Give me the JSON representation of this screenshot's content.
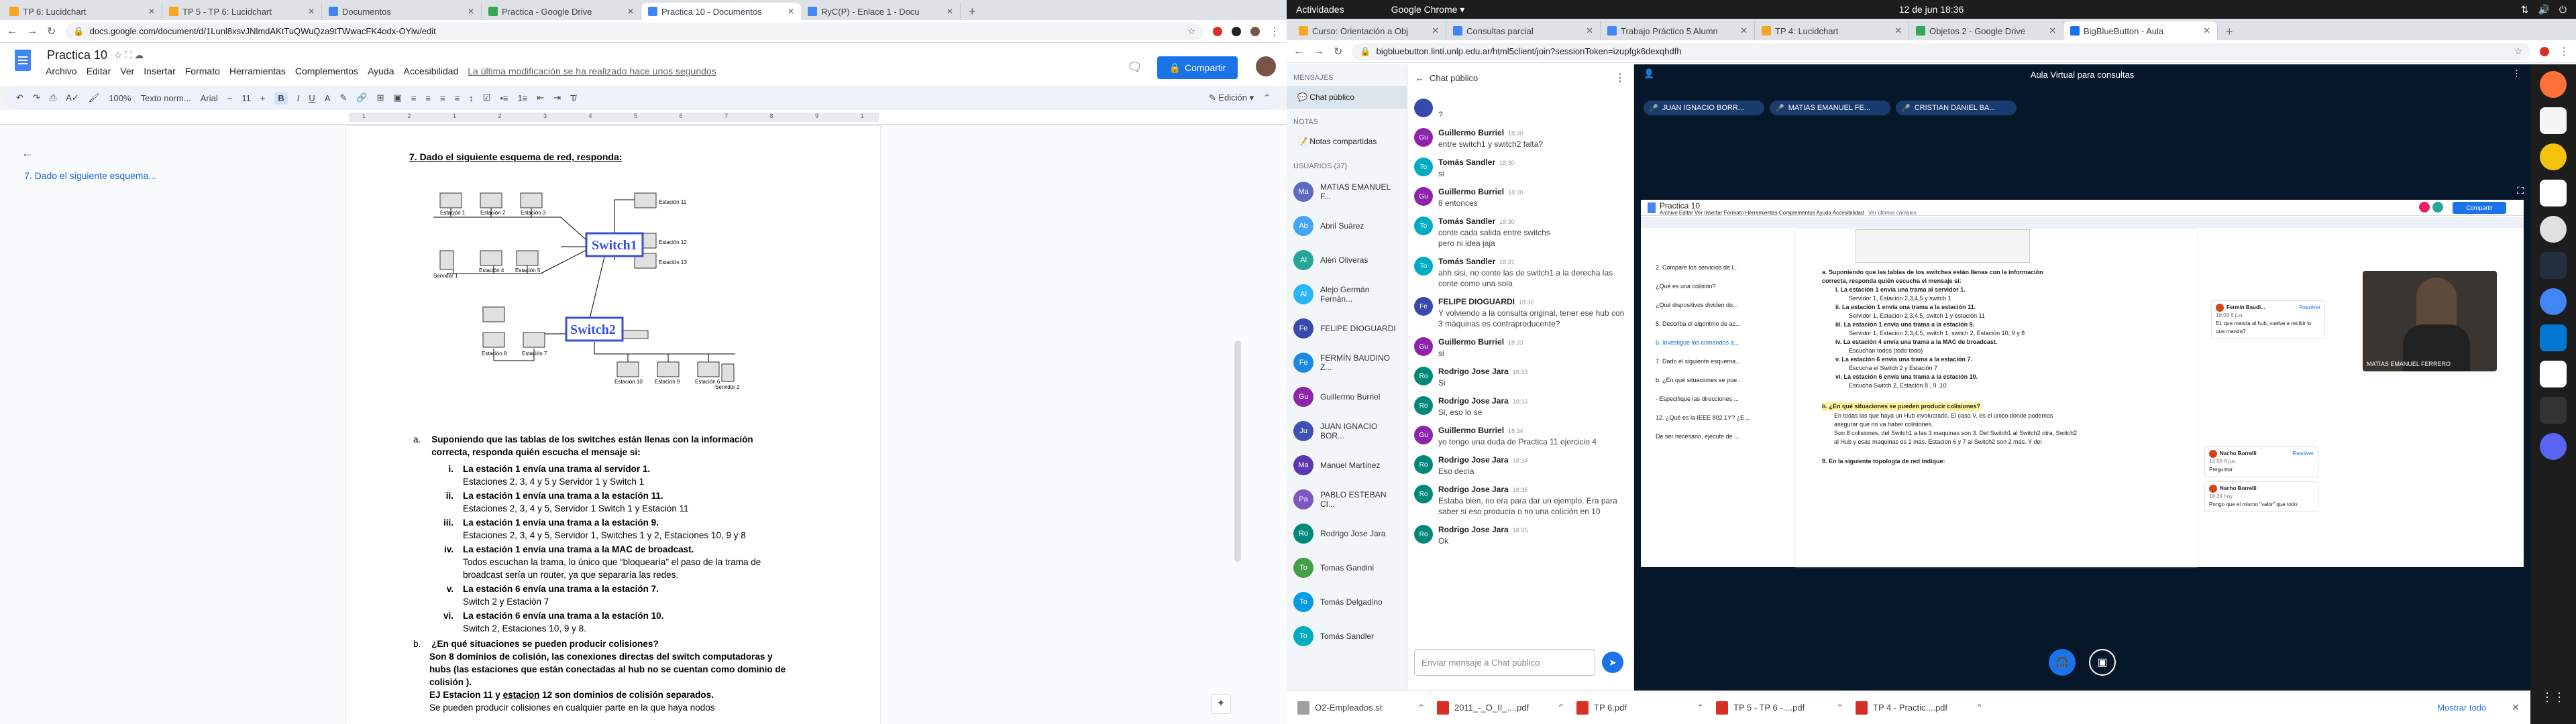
{
  "left_browser": {
    "tabs": [
      {
        "label": "TP 6: Lucidchart",
        "color": "#f5a623"
      },
      {
        "label": "TP 5 - TP 6: Lucidchart",
        "color": "#f5a623"
      },
      {
        "label": "Documentos",
        "color": "#4285f4"
      },
      {
        "label": "Practica - Google Drive",
        "color": "#34a853"
      },
      {
        "label": "Practica 10 - Documentos",
        "color": "#4285f4"
      },
      {
        "label": "RyC(P) - Enlace 1 - Docu",
        "color": "#4285f4"
      }
    ],
    "active_tab_index": 4,
    "url": "docs.google.com/document/d/1Lunl8xsvJNlmdAKtTuQWuQza9tTWwacFK4odx-OYiw/edit"
  },
  "docs": {
    "title": "Practica 10",
    "menus": [
      "Archivo",
      "Editar",
      "Ver",
      "Insertar",
      "Formato",
      "Herramientas",
      "Complementos",
      "Ayuda",
      "Accesibilidad"
    ],
    "last_edit": "La última modificación se ha realizado hace unos segundos",
    "share_label": "Compartir",
    "toolbar": {
      "zoom": "100%",
      "style": "Texto norm...",
      "font": "Arial",
      "size": "11",
      "mode": "Edición"
    },
    "ruler_numbers": "1 2 1 2 3 4 5 6 7 8 9 10 11 12 13 14 15 16 17 18",
    "outline_item": "7. Dado el siguiente esquema...",
    "question_title": "7. Dado el siguiente esquema de red, responda:",
    "diagram": {
      "switch1": "Switch1",
      "switch2": "Switch2",
      "labels": [
        "Estación 1",
        "Estación 2",
        "Estación 3",
        "Estación 11",
        "Estación 12",
        "Servidor 1",
        "Estación 4",
        "Estación 5",
        "Estación 13",
        "Estación 8",
        "Estación 7",
        "Estación 9",
        "Estación 10",
        "Servidor 2",
        "Estación 6"
      ]
    },
    "a_label": "a.",
    "a_text": "Suponiendo que las tablas de los switches están llenas con la información correcta, responda quién escucha el mensaje si:",
    "items": [
      {
        "num": "i.",
        "q": "La estación 1 envía una trama al servidor 1.",
        "a": "Estaciones 2, 3, 4 y 5 y Servidor 1 y Switch 1"
      },
      {
        "num": "ii.",
        "q": "La estación 1 envía una trama a la estación 11.",
        "a": "Estaciones 2, 3, 4 y 5, Servidor 1 Switch 1 y Estación 11"
      },
      {
        "num": "iii.",
        "q": "La estación 1 envía una trama a la estación 9.",
        "a": "Estaciones 2, 3, 4 y 5, Servidor 1, Switches 1 y 2, Estaciones 10, 9 y 8"
      },
      {
        "num": "iv.",
        "q": "La estación 1 envía una trama a la MAC de broadcast.",
        "a": "Todos escuchan la trama, lo único que “bloquearía” el paso de la trama de broadcast sería un router, ya que separaría las redes."
      },
      {
        "num": "v.",
        "q": "La estación 6 envía una trama a la estación 7.",
        "a": "Switch 2 y Estación 7"
      },
      {
        "num": "vi.",
        "q": "La estación 6 envía una trama a la estación 10.",
        "a": "Switch 2, Estaciones 10, 9 y 8."
      }
    ],
    "b_label": "b.",
    "b_q": "¿En qué situaciones se pueden producir colisiones?",
    "b_a1": "Son 8 dominios de colisión, las conexiones directas del switch computadoras y hubs (las estaciones que están conectadas al hub no se cuentan como dominio de colisión ).",
    "b_a2_pre": "EJ Estacion 11 y ",
    "b_a2_u": "estacion",
    "b_a2_post": " 12 son dominios de colisión separados.",
    "b_a3": "Se pueden producir colisiones en cualquier parte en la que haya nodos"
  },
  "gnome": {
    "activities": "Actividades",
    "app": "Google Chrome ▾",
    "clock": "12 de jun  18:36"
  },
  "right_browser": {
    "tabs": [
      {
        "label": "Curso: Orientación a Obj",
        "color": "#f9a825"
      },
      {
        "label": "Consultas parcial",
        "color": "#4285f4"
      },
      {
        "label": "Trabajo Práctico 5 Alumn",
        "color": "#4285f4"
      },
      {
        "label": "TP 4: Lucidchart",
        "color": "#f5a623"
      },
      {
        "label": "Objetos 2 - Google Drive",
        "color": "#34a853"
      },
      {
        "label": "BigBlueButton - Aula",
        "color": "#1a73e8"
      }
    ],
    "url": "bigbluebutton.linti.unlp.edu.ar/html5client/join?sessionToken=izupfgk6dexqhdfh"
  },
  "bbb": {
    "messages_header": "MENSAJES",
    "public_chat": "Chat público",
    "notes_header": "NOTAS",
    "shared_notes": "Notas compartidas",
    "users_header": "USUARIOS (37)",
    "users": [
      {
        "initials": "Ma",
        "name": "MATIAS EMANUEL F...",
        "color": "#5c6bc0"
      },
      {
        "initials": "Ab",
        "name": "Abril Suárez",
        "color": "#42a5f5"
      },
      {
        "initials": "Al",
        "name": "Alén Oliveras",
        "color": "#26a69a"
      },
      {
        "initials": "Al",
        "name": "Alejo Germán Fernán...",
        "color": "#29b6f6"
      },
      {
        "initials": "Fe",
        "name": "FELIPE DIOGUARDI",
        "color": "#3949ab"
      },
      {
        "initials": "Fe",
        "name": "FERMÍN BAUDINO Z...",
        "color": "#1e88e5"
      },
      {
        "initials": "Gu",
        "name": "Guillermo Burriel",
        "color": "#8e24aa"
      },
      {
        "initials": "Ju",
        "name": "JUAN IGNACIO BOR...",
        "color": "#3f51b5"
      },
      {
        "initials": "Ma",
        "name": "Manuel Martínez",
        "color": "#5e35b1"
      },
      {
        "initials": "Pa",
        "name": "PABLO ESTEBAN CI...",
        "color": "#7e57c2"
      },
      {
        "initials": "Ro",
        "name": "Rodrigo Jose Jara",
        "color": "#00897b"
      },
      {
        "initials": "To",
        "name": "Tomas Gandini",
        "color": "#43a047"
      },
      {
        "initials": "To",
        "name": "Tomás Delgadino",
        "color": "#039be5"
      },
      {
        "initials": "To",
        "name": "Tomás Sandler",
        "color": "#00acc1"
      }
    ],
    "chat_title": "Chat público",
    "chat": [
      {
        "initials": "",
        "name": "",
        "time": "",
        "text": "?",
        "color": "#3949ab"
      },
      {
        "initials": "Gu",
        "name": "Guillermo Burriel",
        "time": "18:30",
        "text": "entre switch1 y switch2 falta?",
        "color": "#8e24aa"
      },
      {
        "initials": "To",
        "name": "Tomás Sandler",
        "time": "18:30",
        "text": "si",
        "color": "#00acc1"
      },
      {
        "initials": "Gu",
        "name": "Guillermo Burriel",
        "time": "18:30",
        "text": "8 entonces",
        "color": "#8e24aa"
      },
      {
        "initials": "To",
        "name": "Tomás Sandler",
        "time": "18:30",
        "text": "conte cada salida entre switchs\npero ni idea jaja",
        "color": "#00acc1"
      },
      {
        "initials": "To",
        "name": "Tomás Sandler",
        "time": "18:31",
        "text": "ahh sisi, no conte las de switch1 a la derecha las conte como una sola",
        "color": "#00acc1"
      },
      {
        "initials": "Fe",
        "name": "FELIPE DIOGUARDI",
        "time": "18:32",
        "text": "Y volviendo a la consulta original, tener ese hub con 3 máquinas es contraproducente?",
        "color": "#3949ab"
      },
      {
        "initials": "Gu",
        "name": "Guillermo Burriel",
        "time": "18:33",
        "text": "si",
        "color": "#8e24aa"
      },
      {
        "initials": "Ro",
        "name": "Rodrigo Jose Jara",
        "time": "18:33",
        "text": "Si",
        "color": "#00897b"
      },
      {
        "initials": "Ro",
        "name": "Rodrigo Jose Jara",
        "time": "18:33",
        "text": "Si, eso lo se",
        "color": "#00897b"
      },
      {
        "initials": "Gu",
        "name": "Guillermo Burriel",
        "time": "18:34",
        "text": "yo tengo una duda de Practica 11 ejercicio 4",
        "color": "#8e24aa"
      },
      {
        "initials": "Ro",
        "name": "Rodrigo Jose Jara",
        "time": "18:34",
        "text": "Eso decía",
        "color": "#00897b"
      },
      {
        "initials": "Ro",
        "name": "Rodrigo Jose Jara",
        "time": "18:35",
        "text": "Estaba bien, no era para dar un ejemplo. Era para saber si eso producía o no una colición en 10",
        "color": "#00897b"
      },
      {
        "initials": "Ro",
        "name": "Rodrigo Jose Jara",
        "time": "18:35",
        "text": "Ok",
        "color": "#00897b"
      }
    ],
    "chat_placeholder": "Enviar mensaje a Chat público",
    "room_title": "Aula Virtual para consultas",
    "pills": [
      "JUAN IGNACIO BORR...",
      "MATIAS EMANUEL FE...",
      "CRISTIAN DANIEL BA..."
    ],
    "shared_doc": {
      "title": "Practica 10",
      "menus": "Archivo  Editar  Ver  Insertar  Formato  Herramientas  Complementos  Ayuda  Accesibilidad",
      "last_edit": "Ver últimos cambios",
      "share": "Compartir",
      "outline": [
        "2. Compare los servicios de l...",
        "¿Qué es una colisión?",
        "¿Qué dispositivos dividen do...",
        "5. Describa el algoritmo de ac...",
        "6. Investigue los comandos a...",
        "7. Dado el siguiente esquema...",
        "b. ¿En qué situaciones se pue...",
        "- Especifique las direcciones ...",
        "12. ¿Qué es la IEEE 802.1Y? ¿E...",
        "De ser necesario, ejecute de ..."
      ],
      "lines": [
        "a. Suponiendo que las tablas de los switches están llenas con la información",
        "correcta, responda quién escucha el mensaje si:",
        "i. La estación 1 envía una trama al servidor 1.",
        "Servidor 1, Estación 2,3,4,5 y switch 1",
        "ii. La estación 1 envía una trama a la estación 11.",
        "Servidor 1, Estación 2,3,4,5, switch 1 y estación 11",
        "iii. La estación 1 envía una trama a la estación 9.",
        "Servidor 1, Estación 2,3,4,5, switch 1, switch 2, Estación 10, 9 y 8",
        "iv. La estación 4 envía una trama a la MAC de broadcast.",
        "Escuchan todos (todo todo)",
        "v. La estación 6 envía una trama a la estación 7.",
        "Escucha el Switch 2 y Estación 7",
        "vi. La estación 6 envía una trama a la estación 10.",
        "Escucha Switch 2, Estación 8 , 9 ,10"
      ],
      "b_line": "b. ¿En qué situaciones se pueden producir colisiones?",
      "b_ans": [
        "En todas las que haya un Hub involucrado. El caso V. es el único donde podemos",
        "asegurar que no va haber colisiones.",
        "Son 8 colisiones, del Switch1 a las 3 maquinas son 3. Del Switch1 al Switch2 otra, Switch2",
        "al Hub y esas maquinas es 1 más. Estacion 6 y 7 al Switch2 son 2 más. Y del"
      ],
      "next_q": "9. En la siguiente topología de red indique:",
      "comments": [
        {
          "name": "Fermín Baudi...",
          "time": "18:09 6 jun.",
          "action": "Resolver",
          "text": "EL que manda al hub, vuelve a recibir lo que manda?"
        },
        {
          "name": "Nacho Borrelli",
          "time": "14:58 6 jun.",
          "action": "Resolver",
          "text": "Preguntar"
        },
        {
          "name": "Nacho Borrelli",
          "time": "18:24 hoy",
          "action": "",
          "text": "Pongo que el mismo \"valor\" que todo"
        }
      ],
      "webcam_name": "MATÍAS EMANUEL FERRERO"
    }
  },
  "downloads": [
    {
      "name": "O2-Empleados.st",
      "color": "#9e9e9e"
    },
    {
      "name": "2011_-_O_II_....pdf",
      "color": "#d93025"
    },
    {
      "name": "TP 6.pdf",
      "color": "#d93025"
    },
    {
      "name": "TP 5 - TP 6 -....pdf",
      "color": "#d93025"
    },
    {
      "name": "TP 4 - Practic....pdf",
      "color": "#d93025"
    }
  ],
  "downloads_show_all": "Mostrar todo"
}
